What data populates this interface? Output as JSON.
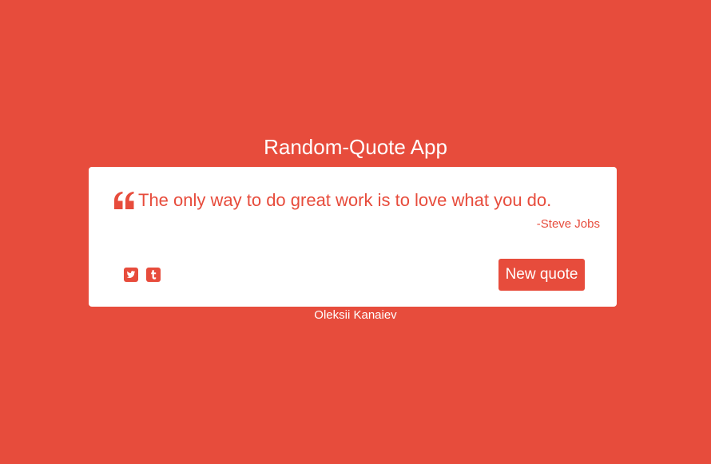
{
  "app": {
    "title": "Random-Quote App"
  },
  "quote": {
    "icon": "quote-left-icon",
    "text": "The only way to do great work is to love what you do.",
    "author": "-Steve Jobs"
  },
  "share": {
    "twitter_icon": "twitter-icon",
    "tumblr_icon": "tumblr-icon"
  },
  "actions": {
    "new_quote_label": "New quote"
  },
  "footer": {
    "author": "Oleksii Kanaiev"
  },
  "colors": {
    "background": "#e74c3c",
    "accent": "#e74c3c",
    "card": "#ffffff",
    "text_light": "#ffffff"
  }
}
